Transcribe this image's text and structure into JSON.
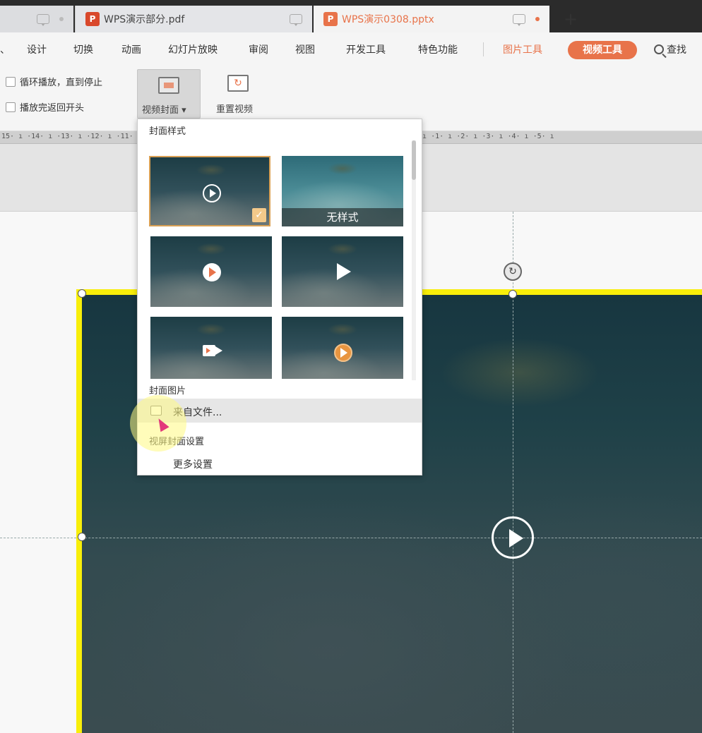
{
  "tabs": [
    {
      "label": ""
    },
    {
      "label": "WPS演示部分.pdf",
      "badge": "P"
    },
    {
      "label": "WPS演示0308.pptx",
      "badge": "P"
    }
  ],
  "new_tab": "+",
  "menu": {
    "items": [
      "设计",
      "切换",
      "动画",
      "幻灯片放映",
      "审阅",
      "视图",
      "开发工具",
      "特色功能"
    ],
    "picture_tools": "图片工具",
    "video_tools": "视频工具",
    "search": "查找"
  },
  "ribbon": {
    "loop_label": "循环播放，直到停止",
    "rewind_label": "播放完返回开头",
    "cover_label": "视频封面 ▾",
    "reset_label": "重置视频"
  },
  "ruler_text": "15· ı ·14· ı ·13· ı ·12· ı ·11· ı ·10· ı ·9· ı ·8· ı ·7· ı ·6· ı ·5· ı ·4· ı ·3· ı ·2· ı ·1· ı ·0· ı ·1· ı ·2· ı ·3· ı ·4· ı ·5· ı",
  "dropdown": {
    "style_header": "封面样式",
    "no_style_label": "无样式",
    "selected_check": "✓",
    "cover_image_header": "封面图片",
    "from_file": "来自文件...",
    "screen_cover_header": "视屏封面设置",
    "more_settings": "更多设置"
  },
  "colors": {
    "accent": "#e8734a",
    "selection_border": "#f8ee0a"
  }
}
